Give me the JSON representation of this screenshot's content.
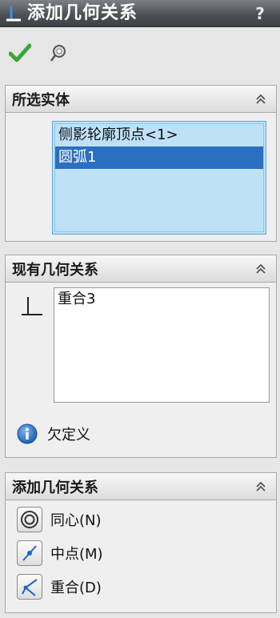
{
  "title": "添加几何关系",
  "help": "?",
  "toolbar": {
    "ok_icon": "checkmark-icon",
    "pin_icon": "pushpin-icon"
  },
  "selected_entities": {
    "title": "所选实体",
    "items": [
      "侧影轮廓顶点<1>",
      "圆弧1"
    ],
    "selected_index": 1
  },
  "existing_relations": {
    "title": "现有几何关系",
    "items": [
      "重合3"
    ],
    "status": "欠定义"
  },
  "add_relations": {
    "title": "添加几何关系",
    "buttons": [
      {
        "label": "同心(N)",
        "icon": "concentric-icon"
      },
      {
        "label": "中点(M)",
        "icon": "midpoint-icon"
      },
      {
        "label": "重合(D)",
        "icon": "coincident-icon"
      }
    ]
  },
  "colors": {
    "titlebar": "#4e5156",
    "selection": "#2a6fc0",
    "list_bg": "#bfe1f7",
    "ok": "#3aa63a"
  }
}
